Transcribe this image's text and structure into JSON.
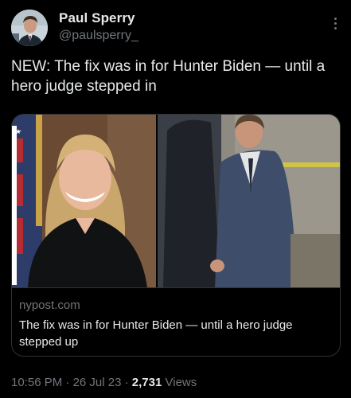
{
  "author": {
    "name": "Paul Sperry",
    "handle": "@paulsperry_"
  },
  "tweet": {
    "text": "NEW: The fix was in for Hunter Biden — until a hero judge stepped in"
  },
  "card": {
    "domain": "nypost.com",
    "title": "The fix was in for Hunter Biden — until a hero judge stepped up"
  },
  "meta": {
    "time": "10:56 PM",
    "separator": "·",
    "date": "26 Jul 23",
    "views_count": "2,731",
    "views_label": "Views"
  },
  "colors": {
    "background": "#000000",
    "text_primary": "#e7e9ea",
    "text_secondary": "#71767b",
    "border": "#2f3336"
  },
  "icons": {
    "more": "more-options-icon"
  }
}
